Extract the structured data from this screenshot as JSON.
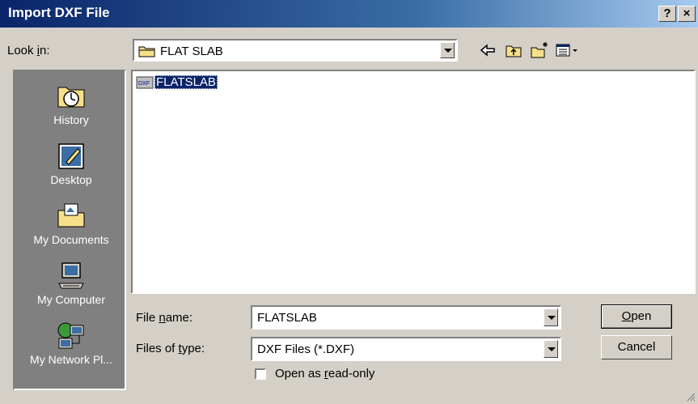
{
  "window": {
    "title": "Import DXF File",
    "help_label": "?",
    "close_label": "×"
  },
  "lookin": {
    "label_pre": "Look ",
    "label_ul": "i",
    "label_post": "n:",
    "value": "FLAT SLAB"
  },
  "toolbar": {
    "back_icon": "back-arrow-icon",
    "up_icon": "up-folder-icon",
    "new_icon": "new-folder-icon",
    "views_icon": "views-menu-icon"
  },
  "places": [
    {
      "label": "History",
      "icon": "history-icon"
    },
    {
      "label": "Desktop",
      "icon": "desktop-icon"
    },
    {
      "label": "My Documents",
      "icon": "my-documents-icon"
    },
    {
      "label": "My Computer",
      "icon": "my-computer-icon"
    },
    {
      "label": "My Network Pl...",
      "icon": "network-places-icon"
    }
  ],
  "files": [
    {
      "name": "FLATSLAB",
      "badge": "DXF"
    }
  ],
  "filename": {
    "label_pre": "File ",
    "label_ul": "n",
    "label_post": "ame:",
    "value": "FLATSLAB"
  },
  "filetype": {
    "label_pre": "Files of ",
    "label_ul": "t",
    "label_post": "ype:",
    "value": "DXF Files (*.DXF)"
  },
  "readonly": {
    "label_pre": "Open as ",
    "label_ul": "r",
    "label_post": "ead-only",
    "checked": false
  },
  "buttons": {
    "open_ul": "O",
    "open_post": "pen",
    "cancel": "Cancel"
  },
  "colors": {
    "title_start": "#0a246a",
    "title_end": "#a6caf0",
    "face": "#d4d0c8",
    "places": "#808080",
    "selection": "#0a246a"
  }
}
